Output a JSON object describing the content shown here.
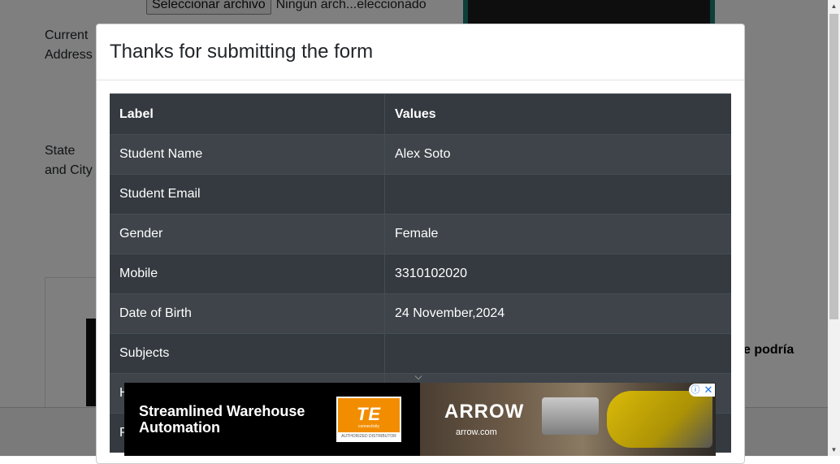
{
  "background": {
    "file_button_label": "Seleccionar archivo",
    "file_status": "Ningún arch...eleccionado",
    "current_address_label": "Current Address",
    "state_city_label": "State and City",
    "side_ad_text": "e podría"
  },
  "modal": {
    "title": "Thanks for submitting the form",
    "table": {
      "headers": [
        "Label",
        "Values"
      ],
      "rows": [
        {
          "label": "Student Name",
          "value": "Alex Soto"
        },
        {
          "label": "Student Email",
          "value": ""
        },
        {
          "label": "Gender",
          "value": "Female"
        },
        {
          "label": "Mobile",
          "value": "3310102020"
        },
        {
          "label": "Date of Birth",
          "value": "24 November,2024"
        },
        {
          "label": "Subjects",
          "value": ""
        },
        {
          "label": "H",
          "value": ""
        },
        {
          "label": "P",
          "value": ""
        }
      ]
    }
  },
  "ad": {
    "headline": "Streamlined Warehouse Automation",
    "brand_te": "TE",
    "brand_te_sub": "connectivity",
    "brand_te_badge": "AUTHORIZED DISTRIBUTOR",
    "brand_arrow": "ARROW",
    "arrow_url": "arrow.com",
    "info_icon": "ⓘ",
    "close_icon": "✕",
    "colors": {
      "te_orange": "#f28d00",
      "background": "#000000"
    }
  },
  "scrollbar": {
    "up": "▲",
    "down": "▼"
  },
  "chevron": "⌵"
}
